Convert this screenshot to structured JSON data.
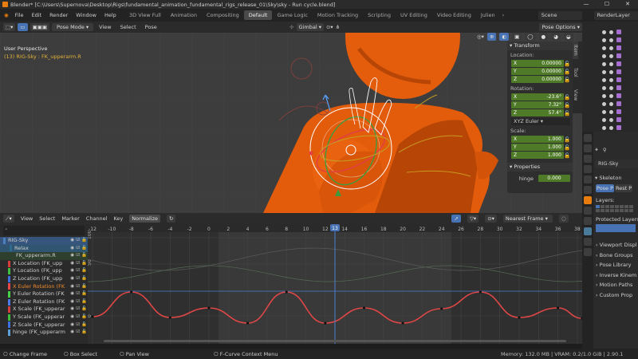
{
  "window": {
    "app": "Blender*",
    "path": "[C:\\Users\\Supernova\\Desktop\\Rigs\\fundamental_animation_fundamental_rigs_release_01\\Sky\\sky - Run cycle.blend]"
  },
  "menu": [
    "File",
    "Edit",
    "Render",
    "Window",
    "Help"
  ],
  "workspaces": [
    "3D View Full",
    "Animation",
    "Compositing",
    "Default",
    "Game Logic",
    "Motion Tracking",
    "Scripting",
    "UV Editing",
    "Video Editing",
    "Julien"
  ],
  "active_workspace": "Default",
  "scene": "Scene",
  "render_layer": "RenderLayer",
  "viewport": {
    "mode": "Pose Mode",
    "menus": [
      "View",
      "Select",
      "Pose"
    ],
    "orientation": "Gimbal",
    "pose_options": "Pose Options",
    "view_name": "User Perspective",
    "object_info": "(13) RIG-Sky : FK_upperarm.R",
    "tabs": [
      "Item",
      "Tool",
      "View"
    ],
    "transform": {
      "header": "Transform",
      "location_label": "Location:",
      "location": [
        {
          "axis": "X",
          "value": "0.00000"
        },
        {
          "axis": "Y",
          "value": "0.00000"
        },
        {
          "axis": "Z",
          "value": "0.00000"
        }
      ],
      "rotation_label": "Rotation:",
      "rotation": [
        {
          "axis": "X",
          "value": "-23.6°"
        },
        {
          "axis": "Y",
          "value": "7.32°"
        },
        {
          "axis": "Z",
          "value": "57.4°"
        }
      ],
      "rotation_mode": "XYZ Euler",
      "scale_label": "Scale:",
      "scale": [
        {
          "axis": "X",
          "value": "1.000"
        },
        {
          "axis": "Y",
          "value": "1.000"
        },
        {
          "axis": "Z",
          "value": "1.000"
        }
      ]
    },
    "properties": {
      "header": "Properties",
      "hinge_label": "hinge",
      "hinge_value": "0.000"
    }
  },
  "graph_editor": {
    "menus": [
      "View",
      "Select",
      "Marker",
      "Channel",
      "Key"
    ],
    "normalize": "Normalize",
    "snap": "Nearest Frame",
    "current_frame": "13",
    "frame_ticks": [
      "-12",
      "-10",
      "-8",
      "-6",
      "-4",
      "-2",
      "0",
      "2",
      "4",
      "6",
      "8",
      "10",
      "12",
      "14",
      "16",
      "18",
      "20",
      "22",
      "24",
      "26",
      "28",
      "30",
      "32",
      "34",
      "36",
      "38"
    ],
    "y_ticks": [
      "100",
      "50",
      "0"
    ],
    "channels": [
      {
        "name": "RIG-Sky",
        "color": "#4c7fbf"
      },
      {
        "name": "Relax",
        "color": "#2f6b8f"
      },
      {
        "name": "FK_upperarm.R",
        "color": "#2e3f2e"
      },
      {
        "name": "X Location (FK_upp",
        "color": "#d63c3c"
      },
      {
        "name": "Y Location (FK_upp",
        "color": "#3fbf3f"
      },
      {
        "name": "Z Location (FK_upp",
        "color": "#3f6fdf"
      },
      {
        "name": "X Euler Rotation (FK",
        "color": "#e84848"
      },
      {
        "name": "Y Euler Rotation (FK",
        "color": "#48d048"
      },
      {
        "name": "Z Euler Rotation (FK",
        "color": "#4c7ae8"
      },
      {
        "name": "X Scale (FK_upperar",
        "color": "#d63c3c"
      },
      {
        "name": "Y Scale (FK_upperar",
        "color": "#3fbf3f"
      },
      {
        "name": "Z Scale (FK_upperar",
        "color": "#3f6fdf"
      },
      {
        "name": "hinge (FK_upperarm",
        "color": "#5fa0d8"
      }
    ]
  },
  "outliner_rows": 13,
  "properties_panel": {
    "object": "RIG-Sky",
    "section": "Skeleton",
    "pose_position": "Pose P",
    "rest_position": "Rest P",
    "layers": "Layers:",
    "protected_layers": "Protected Layers:",
    "subpanels": [
      "Viewport Displ",
      "Bone Groups",
      "Pose Library",
      "Inverse Kinem",
      "Motion Paths",
      "Custom Prop"
    ]
  },
  "statusbar": {
    "change_frame": "Change Frame",
    "box_select": "Box Select",
    "pan_view": "Pan View",
    "context_menu": "F-Curve Context Menu",
    "memory": "Memory: 132.0 MB | VRAM: 0.2/1.0 GiB | 2.90.1"
  },
  "colors": {
    "accent": "#e87d0d",
    "active_blue": "#4772b3",
    "field_green": "#4f7a28",
    "character": "#e05a0a",
    "curve_red": "#e04646"
  }
}
